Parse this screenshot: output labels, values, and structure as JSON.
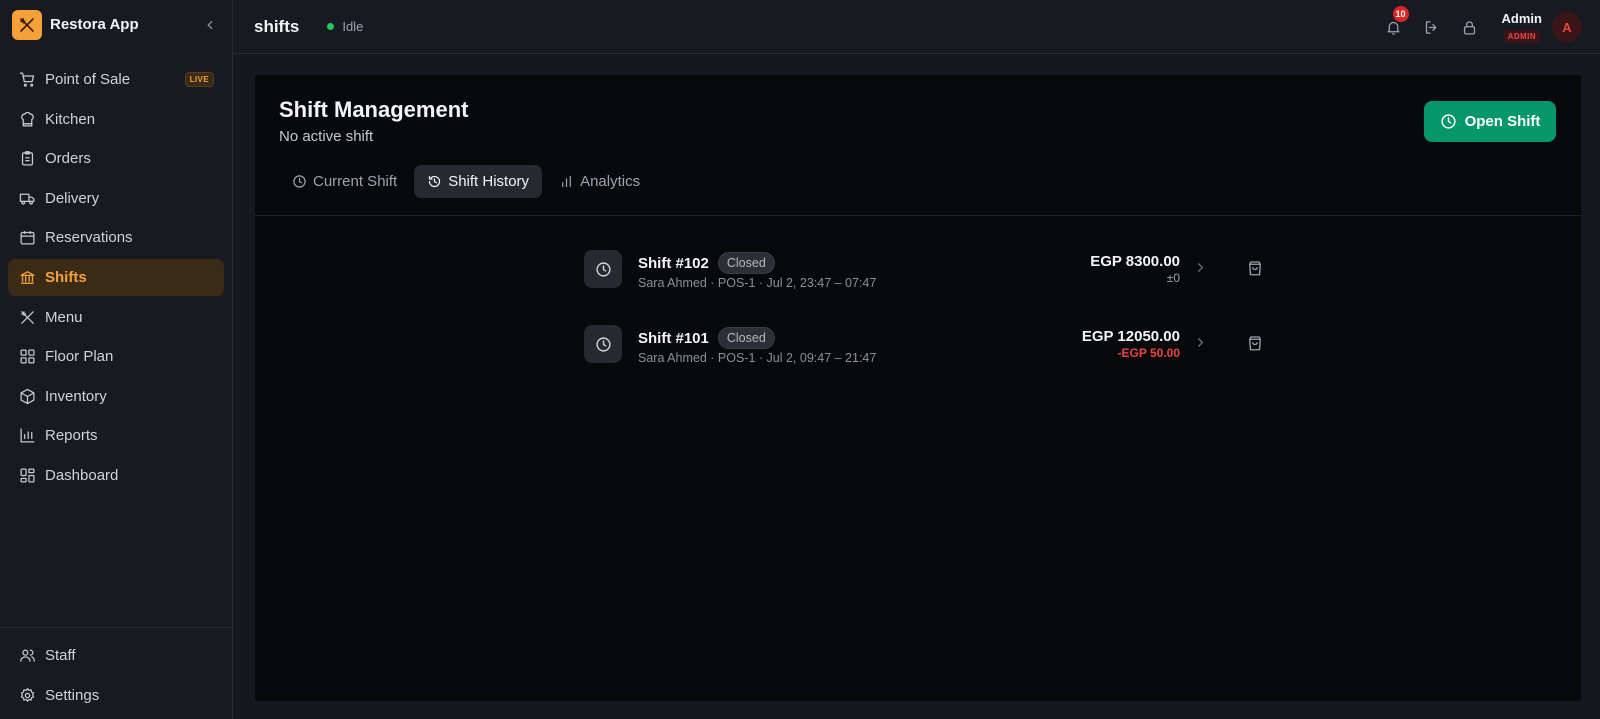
{
  "app": {
    "name": "Restora App"
  },
  "sidebar": {
    "items": [
      {
        "label": "Point of Sale",
        "icon": "cart-icon",
        "badge": "LIVE"
      },
      {
        "label": "Kitchen",
        "icon": "chef-hat-icon"
      },
      {
        "label": "Orders",
        "icon": "clipboard-icon"
      },
      {
        "label": "Delivery",
        "icon": "truck-icon"
      },
      {
        "label": "Reservations",
        "icon": "calendar-icon"
      },
      {
        "label": "Shifts",
        "icon": "bank-icon",
        "active": true
      },
      {
        "label": "Menu",
        "icon": "utensils-icon"
      },
      {
        "label": "Floor Plan",
        "icon": "grid-icon"
      },
      {
        "label": "Inventory",
        "icon": "box-icon"
      },
      {
        "label": "Reports",
        "icon": "bar-chart-icon"
      },
      {
        "label": "Dashboard",
        "icon": "dashboard-icon"
      }
    ],
    "bottom_items": [
      {
        "label": "Staff",
        "icon": "users-icon"
      },
      {
        "label": "Settings",
        "icon": "gear-icon"
      }
    ]
  },
  "topbar": {
    "title": "shifts",
    "status": "Idle",
    "notifications": "10",
    "user": {
      "name": "Admin",
      "role": "ADMIN",
      "initial": "A"
    }
  },
  "main": {
    "title": "Shift Management",
    "subtitle": "No active shift",
    "open_shift_label": "Open Shift",
    "tabs": [
      {
        "label": "Current Shift",
        "icon": "clock-icon"
      },
      {
        "label": "Shift History",
        "icon": "history-icon",
        "active": true
      },
      {
        "label": "Analytics",
        "icon": "bar-chart-icon"
      }
    ],
    "shifts": [
      {
        "name": "Shift #102",
        "status": "Closed",
        "meta": "Sara Ahmed · POS-1 · Jul 2, 23:47 – 07:47",
        "amount": "EGP 8300.00",
        "diff": "±0",
        "diff_negative": false
      },
      {
        "name": "Shift #101",
        "status": "Closed",
        "meta": "Sara Ahmed · POS-1 · Jul 2, 09:47 – 21:47",
        "amount": "EGP 12050.00",
        "diff": "-EGP 50.00",
        "diff_negative": true
      }
    ]
  },
  "colors": {
    "accent": "#f6a03a",
    "success": "#059669",
    "danger": "#ef4444"
  }
}
